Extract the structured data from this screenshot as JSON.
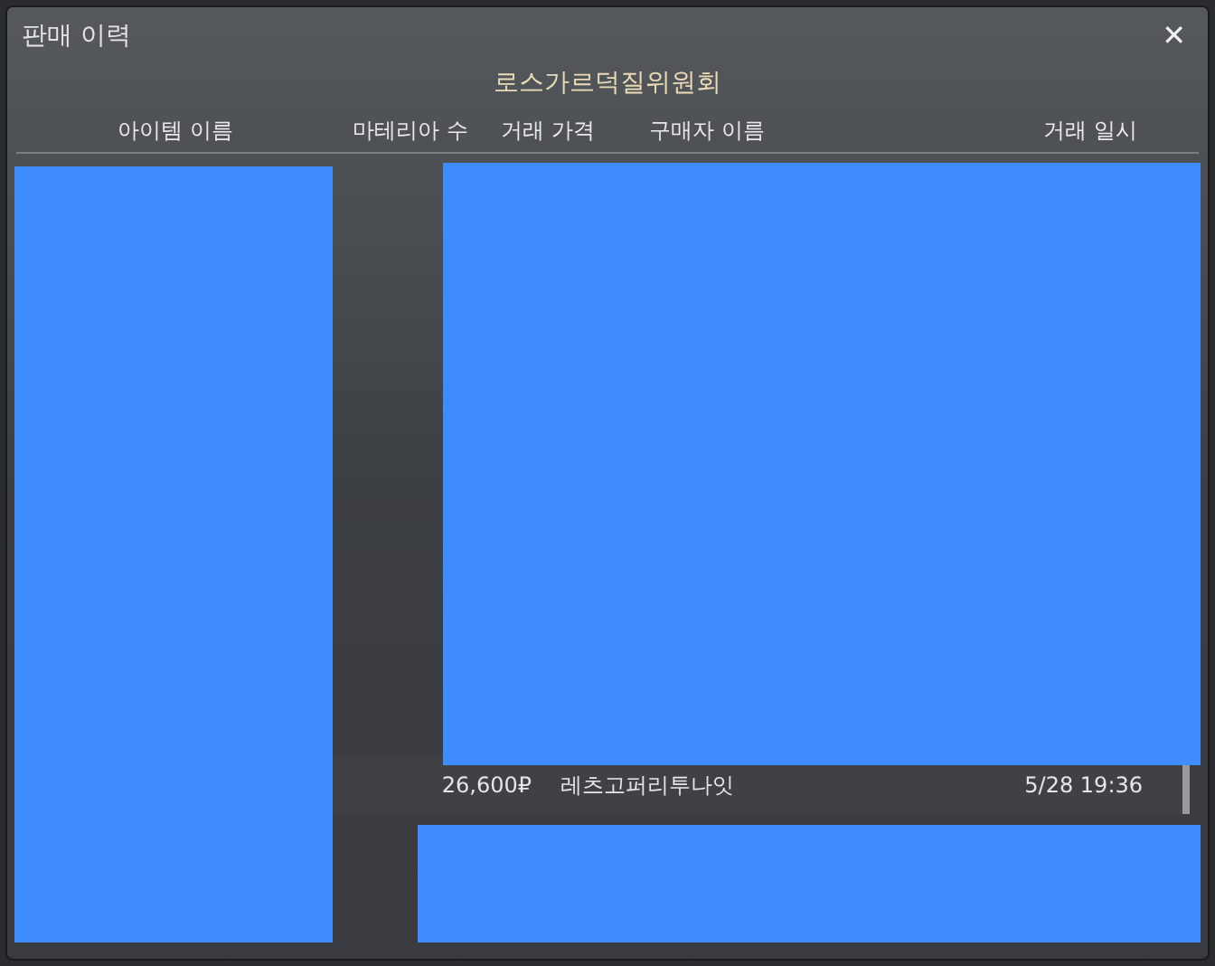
{
  "window": {
    "title": "판매 이력",
    "close": "✕"
  },
  "guild_name": "로스가르덕질위원회",
  "table": {
    "columns": [
      "아이템 이름",
      "마테리아 수",
      "거래 가격",
      "구매자 이름",
      "거래 일시"
    ],
    "rows": [
      {
        "price": "26,600₽",
        "buyer": "레츠고퍼리투나잇",
        "date": "5/28 19:36"
      }
    ]
  }
}
